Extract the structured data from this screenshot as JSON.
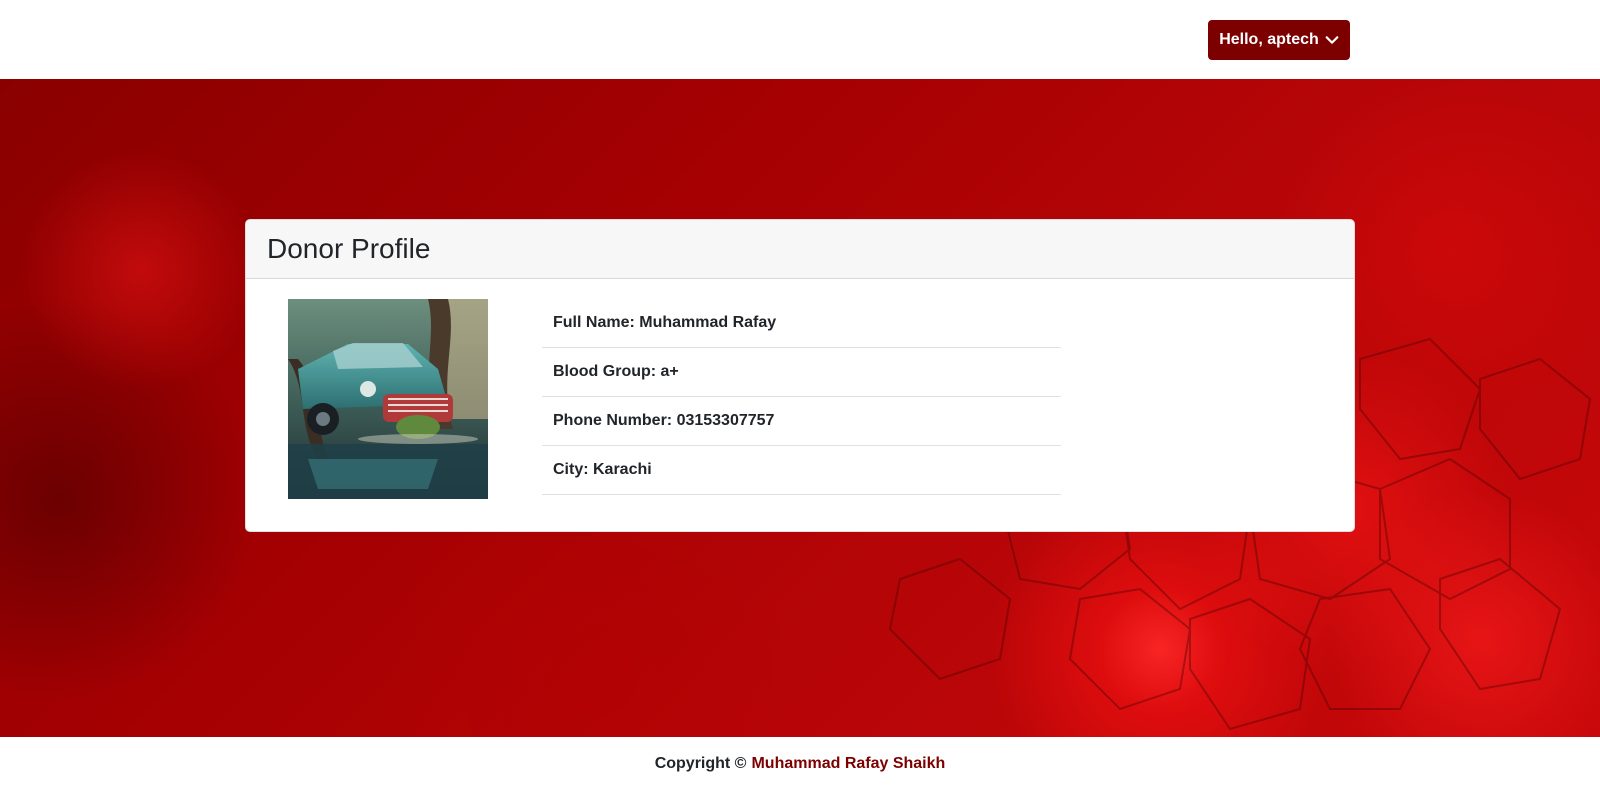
{
  "header": {
    "user_menu_label": "Hello, aptech",
    "user_menu_icon": "chevron-down-icon"
  },
  "profile": {
    "title": "Donor Profile",
    "photo_description": "vintage teal car in forest",
    "fields": [
      {
        "label": "Full Name: Muhammad Rafay"
      },
      {
        "label": "Blood Group: a+"
      },
      {
        "label": "Phone Number: 03153307757"
      },
      {
        "label": "City: Karachi"
      }
    ]
  },
  "footer": {
    "copyright_prefix": "Copyright ©",
    "author_link": "Muhammad Rafay Shaikh"
  },
  "colors": {
    "accent": "#7c0000",
    "hero_base": "#a50002"
  }
}
